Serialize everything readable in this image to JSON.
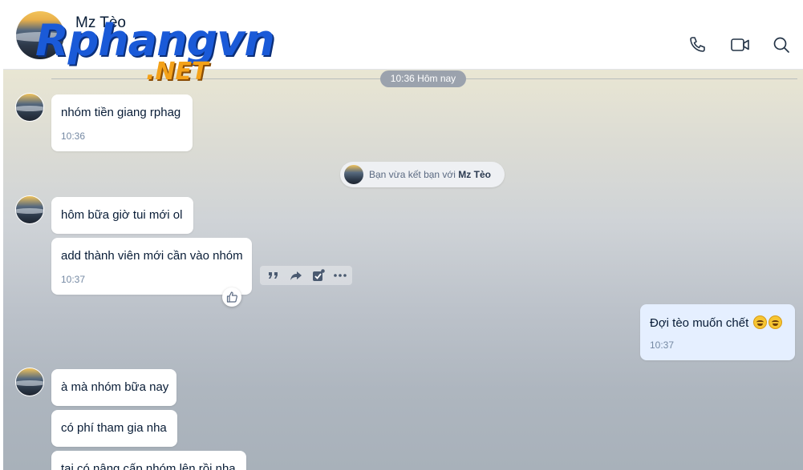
{
  "header": {
    "contact_name": "Mz Tèo",
    "icons": [
      "phone-icon",
      "video-call-icon",
      "search-icon"
    ]
  },
  "logo": {
    "main": "Rphangvn",
    "sub": ".NET"
  },
  "chat": {
    "date_divider": "10:36 Hôm nay",
    "notice": {
      "prefix": "Bạn vừa kết bạn với ",
      "name": "Mz Tèo"
    },
    "messages": [
      {
        "text": "nhóm tiền giang rphag",
        "time": "10:36"
      },
      {
        "text": "hôm bữa giờ tui mới ol"
      },
      {
        "text": "add thành viên mới cần vào nhóm",
        "time": "10:37"
      },
      {
        "text": "Đợi tèo muốn chết",
        "time": "10:37",
        "sender": "me"
      },
      {
        "text": "à mà nhóm bữa nay"
      },
      {
        "text": "có phí tham gia nha"
      },
      {
        "text": "tại có nâng cấp nhóm lên rồi nha"
      }
    ],
    "message_actions": [
      "quote-icon",
      "share-icon",
      "mark-done-icon",
      "more-icon"
    ],
    "reaction_icon": "thumbs-up-icon"
  },
  "colors": {
    "bubble_other": "#ffffff",
    "bubble_me": "#e5efff",
    "timestamp": "#7589a3",
    "pill": "#9ba2ad"
  }
}
